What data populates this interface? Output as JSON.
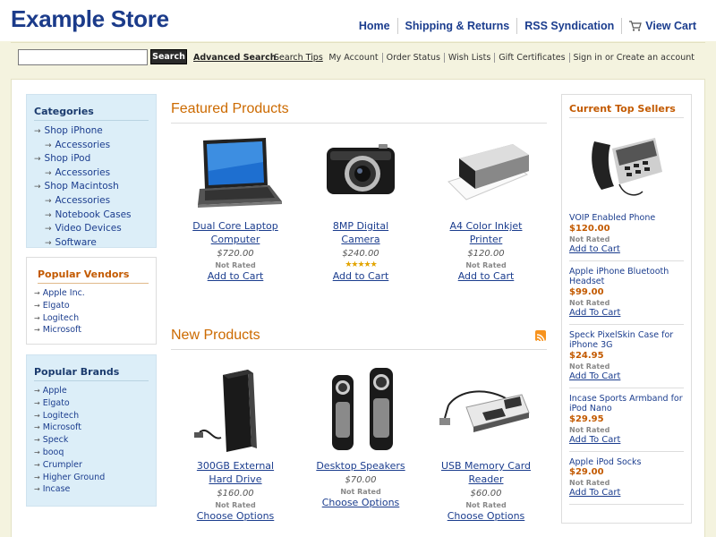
{
  "logo": "Example Store",
  "topnav": [
    "Home",
    "Shipping & Returns",
    "RSS Syndication",
    "View Cart"
  ],
  "search": {
    "placeholder": "",
    "button": "Search",
    "advanced": "Advanced Search",
    "tips": "Search Tips"
  },
  "account_links": [
    "My Account",
    "Order Status",
    "Wish Lists",
    "Gift Certificates"
  ],
  "signin": {
    "sign_in": "Sign in",
    "or": "or",
    "create": "Create an account"
  },
  "categories": {
    "title": "Categories",
    "items": [
      {
        "label": "Shop iPhone",
        "sub": false
      },
      {
        "label": "Accessories",
        "sub": true
      },
      {
        "label": "Shop iPod",
        "sub": false
      },
      {
        "label": "Accessories",
        "sub": true
      },
      {
        "label": "Shop Macintosh",
        "sub": false
      },
      {
        "label": "Accessories",
        "sub": true
      },
      {
        "label": "Notebook Cases",
        "sub": true
      },
      {
        "label": "Video Devices",
        "sub": true
      },
      {
        "label": "Software",
        "sub": true
      }
    ]
  },
  "vendors": {
    "title": "Popular Vendors",
    "items": [
      "Apple Inc.",
      "Elgato",
      "Logitech",
      "Microsoft"
    ]
  },
  "brands": {
    "title": "Popular Brands",
    "items": [
      "Apple",
      "Elgato",
      "Logitech",
      "Microsoft",
      "Speck",
      "booq",
      "Crumpler",
      "Higher Ground",
      "Incase"
    ]
  },
  "featured": {
    "title": "Featured Products",
    "products": [
      {
        "name_line1": "Dual Core Laptop",
        "name_line2": "Computer",
        "price": "$720.00",
        "rating": "Not Rated",
        "action": "Add to Cart",
        "icon": "laptop-icon"
      },
      {
        "name_line1": "8MP Digital",
        "name_line2": "Camera",
        "price": "$240.00",
        "rating": "★★★★★",
        "action": "Add to Cart",
        "icon": "camera-icon"
      },
      {
        "name_line1": "A4 Color Inkjet",
        "name_line2": "Printer",
        "price": "$120.00",
        "rating": "Not Rated",
        "action": "Add to Cart",
        "icon": "printer-icon"
      }
    ]
  },
  "new_products": {
    "title": "New Products",
    "products": [
      {
        "name_line1": "300GB External",
        "name_line2": "Hard Drive",
        "price": "$160.00",
        "rating": "Not Rated",
        "action": "Choose Options",
        "icon": "hard-drive-icon"
      },
      {
        "name_line1": "Desktop Speakers",
        "name_line2": "",
        "price": "$70.00",
        "rating": "Not Rated",
        "action": "Choose Options",
        "icon": "speakers-icon"
      },
      {
        "name_line1": "USB Memory Card",
        "name_line2": "Reader",
        "price": "$60.00",
        "rating": "Not Rated",
        "action": "Choose Options",
        "icon": "card-reader-icon"
      }
    ]
  },
  "top_sellers": {
    "title": "Current Top Sellers",
    "items": [
      {
        "name": "VOIP Enabled Phone",
        "price": "$120.00",
        "rating": "Not Rated",
        "action": "Add to Cart"
      },
      {
        "name": "Apple iPhone Bluetooth Headset",
        "price": "$99.00",
        "rating": "Not Rated",
        "action": "Add To Cart"
      },
      {
        "name": "Speck PixelSkin Case for iPhone 3G",
        "price": "$24.95",
        "rating": "Not Rated",
        "action": "Add To Cart"
      },
      {
        "name": "Incase Sports Armband for iPod Nano",
        "price": "$29.95",
        "rating": "Not Rated",
        "action": "Add To Cart"
      },
      {
        "name": "Apple iPod Socks",
        "price": "$29.00",
        "rating": "Not Rated",
        "action": "Add To Cart"
      }
    ]
  }
}
